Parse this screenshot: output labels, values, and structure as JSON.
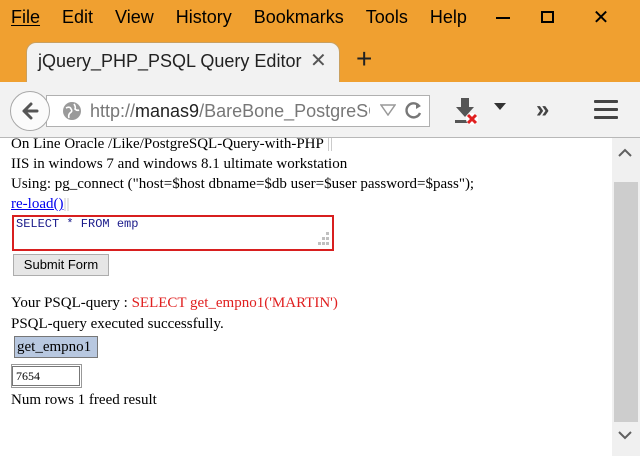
{
  "menubar": {
    "items": [
      "File",
      "Edit",
      "View",
      "History",
      "Bookmarks",
      "Tools",
      "Help"
    ]
  },
  "window_controls": {
    "close_glyph": "✕"
  },
  "tab": {
    "title": "jQuery_PHP_PSQL Query Editor",
    "close_glyph": "✕",
    "new_tab_glyph": "+"
  },
  "navbar": {
    "url_prefix": "http://",
    "url_host": "manas9",
    "url_rest": "/BareBone_PostgreSC",
    "reload_glyph": "C",
    "overflow_glyph": "»"
  },
  "page": {
    "line1": "On Line Oracle /Like/PostgreSQL-Query-with-PHP",
    "line1_sep": "||",
    "line2": "IIS in windows 7 and windows 8.1 ultimate workstation",
    "line3": "Using: pg_connect (\"host=$host dbname=$db user=$user password=$pass\");",
    "reload_link": "re-load()",
    "reload_sep": "||",
    "query_value": "SELECT * FROM emp",
    "submit_label": "Submit Form",
    "your_query_label": "Your PSQL-query : ",
    "your_query_sql": "SELECT get_empno1('MARTIN')",
    "status": "PSQL-query executed successfully.",
    "result": {
      "columns": [
        "get_empno1"
      ],
      "rows": [
        [
          "7654"
        ]
      ]
    },
    "footer": "Num rows 1 freed result"
  },
  "colors": {
    "chrome_accent": "#f0a030",
    "query_border": "#d81f1f",
    "sql_text": "#e02020",
    "link": "#0000ee"
  }
}
